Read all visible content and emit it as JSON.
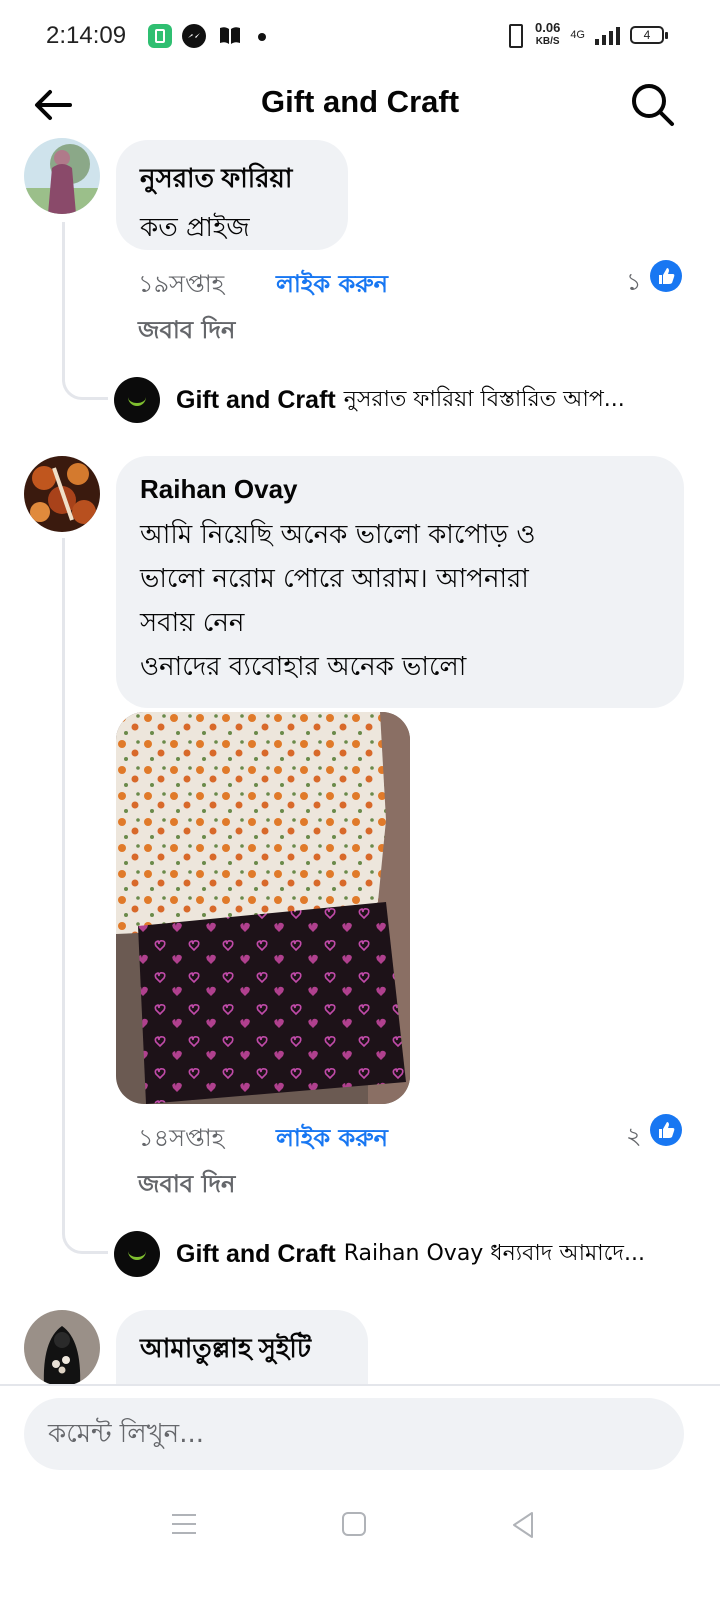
{
  "status_bar": {
    "time": "2:14:09",
    "net_speed_value": "0.06",
    "net_speed_unit": "KB/S",
    "network_type": "4G",
    "battery_level": "4",
    "icons": [
      "app-icon",
      "messenger-icon",
      "book-icon",
      "dot-icon",
      "vibrate-icon",
      "signal-icon",
      "battery-icon"
    ]
  },
  "header": {
    "title": "Gift and Craft",
    "back_icon": "arrow-left-icon",
    "search_icon": "search-icon"
  },
  "comments": [
    {
      "author": "নুসরাত ফারিয়া",
      "lines": [
        "কত প্রাইজ"
      ],
      "time": "১৯সপ্তাহ",
      "like_label": "লাইক করুন",
      "reply_label": "জবাব দিন",
      "reactions": "১",
      "page_reply": {
        "name": "Gift and Craft",
        "text": "নুসরাত ফারিয়া বিস্তারিত আপ..."
      }
    },
    {
      "author": "Raihan Ovay",
      "lines": [
        "আমি নিয়েছি অনেক ভালো কাপোড় ও",
        "ভালো নরোম পোরে আরাম। আপনারা",
        "সবায় নেন",
        "ওনাদের ব্যবোহার অনেক ভালো"
      ],
      "time": "১৪সপ্তাহ",
      "like_label": "লাইক করুন",
      "reply_label": "জবাব দিন",
      "reactions": "২",
      "page_reply": {
        "name": "Gift and Craft",
        "text": "Raihan Ovay ধন্যবাদ আমাদে..."
      }
    },
    {
      "author": "আমাতুল্লাহ সুইটি"
    }
  ],
  "composer": {
    "placeholder": "কমেন্ট লিখুন..."
  },
  "colors": {
    "accent": "#1877f2",
    "bubble": "#f0f2f5",
    "muted_text": "#65676b"
  }
}
